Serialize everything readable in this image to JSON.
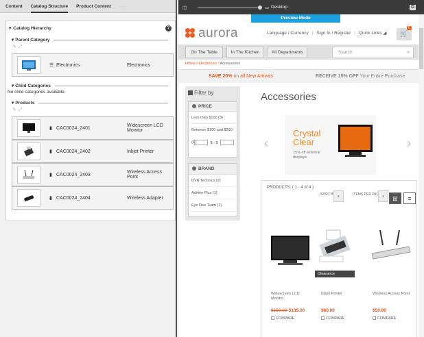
{
  "editor": {
    "tabs": [
      "Content",
      "Catalog Structure",
      "Product Content"
    ],
    "more": "···",
    "hierarchy_title": "Catalog Hierarchy",
    "help": "?",
    "parent_section": "Parent Category",
    "parent": {
      "code": "Electronics",
      "name": "Electronics"
    },
    "child_section": "Child Categories",
    "no_child": "No child categories available.",
    "products_section": "Products",
    "products": [
      {
        "code": "CAC0024_2401",
        "name": "Widescreen LCD Monitor"
      },
      {
        "code": "CAC0024_2402",
        "name": "Inkjet Printer"
      },
      {
        "code": "CAC0024_2403",
        "name": "Wireless Access Point"
      },
      {
        "code": "CAC0024_2404",
        "name": "Wireless Adapter"
      }
    ]
  },
  "preview": {
    "device": "Desktop",
    "mode": "Preview Mode",
    "logo": "aurora",
    "header_links": [
      "Language / Currency",
      "Sign In / Register",
      "Quick Links"
    ],
    "cart_count": "0",
    "nav": [
      "On The Table",
      "In The Kitchen",
      "All Departments"
    ],
    "search_placeholder": "Search",
    "breadcrumb": [
      "Home",
      "Electronics",
      "Accessories"
    ],
    "promo1_bold": "SAVE 20%",
    "promo1_rest": "on all New Arrivals",
    "promo2_bold": "RECEIVE 15% OFF",
    "promo2_rest": "Your Entire Purchase",
    "filter_title": "Filter by",
    "price_head": "PRICE",
    "price_rows": [
      "Less than $100 (3)",
      "Between $100 and $200 (1)"
    ],
    "price_sep": "$ - $",
    "brand_head": "BRAND",
    "brand_rows": [
      "DVR Technics (2)",
      "Adelee Plus (1)",
      "Eye Dee Team (1)"
    ],
    "page_title": "Accessories",
    "banner_t1": "Crystal",
    "banner_t2": "Clear",
    "banner_sub": "15% off external displays",
    "products_head": "PRODUCTS: ( 1 - 4 of 4 )",
    "sort_by": "SORT BY:",
    "items_per_page": "ITEMS PER PAGE:",
    "clearance": "Clearance",
    "compare": "COMPARE",
    "cards": [
      {
        "name": "Widescreen LCD Monitor",
        "old": "$150.00",
        "price": "$135.00"
      },
      {
        "name": "Inkjet Printer",
        "old": "",
        "price": "$60.00"
      },
      {
        "name": "Wireless Access Point",
        "old": "",
        "price": "$50.00"
      }
    ],
    "colors": {
      "brand": "#f05a1a",
      "preview": "#1ba1e2"
    }
  }
}
